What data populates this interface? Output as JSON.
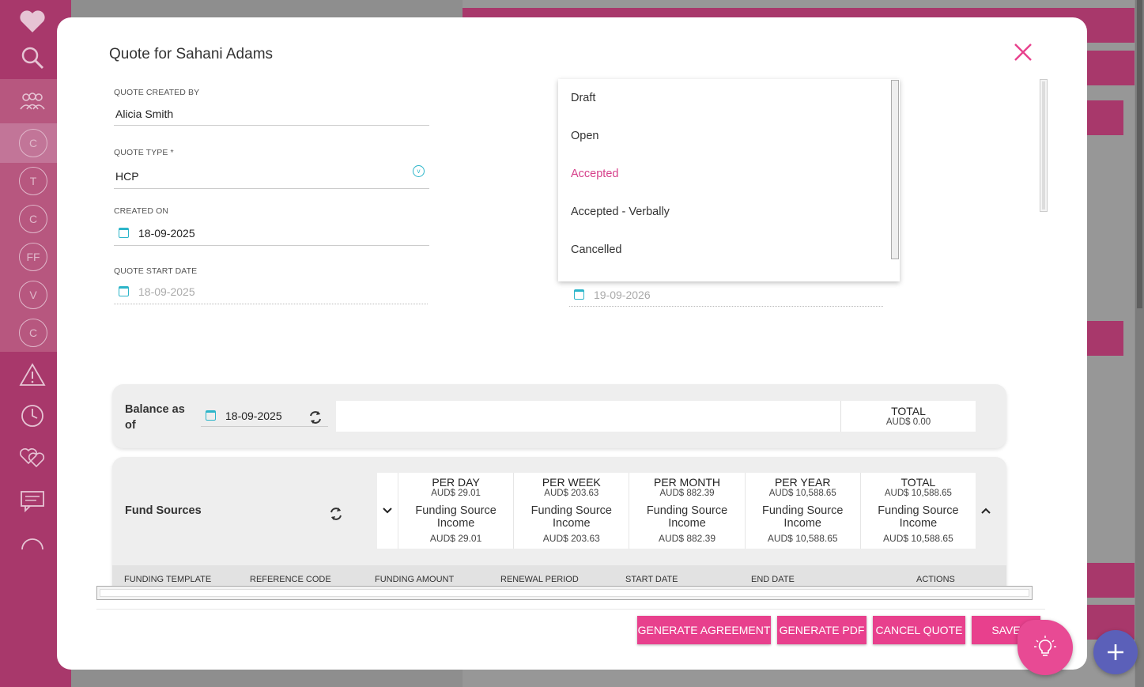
{
  "app": {
    "sidebar": {
      "initials": [
        "C",
        "T",
        "C",
        "FF",
        "V",
        "C"
      ]
    },
    "colors": {
      "brand": "#e8408d",
      "accent": "#2cb5c9",
      "selected_option": "#d63f8a",
      "fab_plus": "#5b60b9"
    }
  },
  "modal": {
    "title": "Quote for Sahani Adams",
    "fields": {
      "created_by": {
        "label": "QUOTE CREATED BY",
        "value": "Alicia Smith"
      },
      "quote_type": {
        "label": "QUOTE TYPE *",
        "value": "HCP"
      },
      "created_on": {
        "label": "CREATED ON",
        "value": "18-09-2025"
      },
      "start_date": {
        "label": "QUOTE START DATE",
        "value": "18-09-2025"
      },
      "end_date": {
        "value": "19-09-2026"
      }
    },
    "status_dropdown": {
      "options": [
        "Draft",
        "Open",
        "Accepted",
        "Accepted - Verbally",
        "Cancelled"
      ],
      "selected": "Accepted"
    },
    "balance": {
      "label": "Balance as of",
      "date": "18-09-2025",
      "total_label": "TOTAL",
      "total_value": "AUD$ 0.00"
    },
    "fund_sources": {
      "title": "Fund Sources",
      "columns": [
        {
          "header": "PER DAY",
          "value": "AUD$ 29.01",
          "source": "Funding Source Income",
          "source_value": "AUD$ 29.01"
        },
        {
          "header": "PER WEEK",
          "value": "AUD$ 203.63",
          "source": "Funding Source Income",
          "source_value": "AUD$ 203.63"
        },
        {
          "header": "PER MONTH",
          "value": "AUD$ 882.39",
          "source": "Funding Source Income",
          "source_value": "AUD$ 882.39"
        },
        {
          "header": "PER YEAR",
          "value": "AUD$ 10,588.65",
          "source": "Funding Source Income",
          "source_value": "AUD$ 10,588.65"
        },
        {
          "header": "TOTAL",
          "value": "AUD$ 10,588.65",
          "source": "Funding Source Income",
          "source_value": "AUD$ 10,588.65"
        }
      ],
      "table_headers": [
        "FUNDING TEMPLATE",
        "REFERENCE CODE",
        "FUNDING AMOUNT",
        "RENEWAL PERIOD",
        "START DATE",
        "END DATE",
        "ACTIONS"
      ]
    },
    "buttons": {
      "generate_agreement": "GENERATE AGREEMENT",
      "generate_pdf": "GENERATE PDF",
      "cancel_quote": "CANCEL QUOTE",
      "save": "SAVE"
    }
  }
}
